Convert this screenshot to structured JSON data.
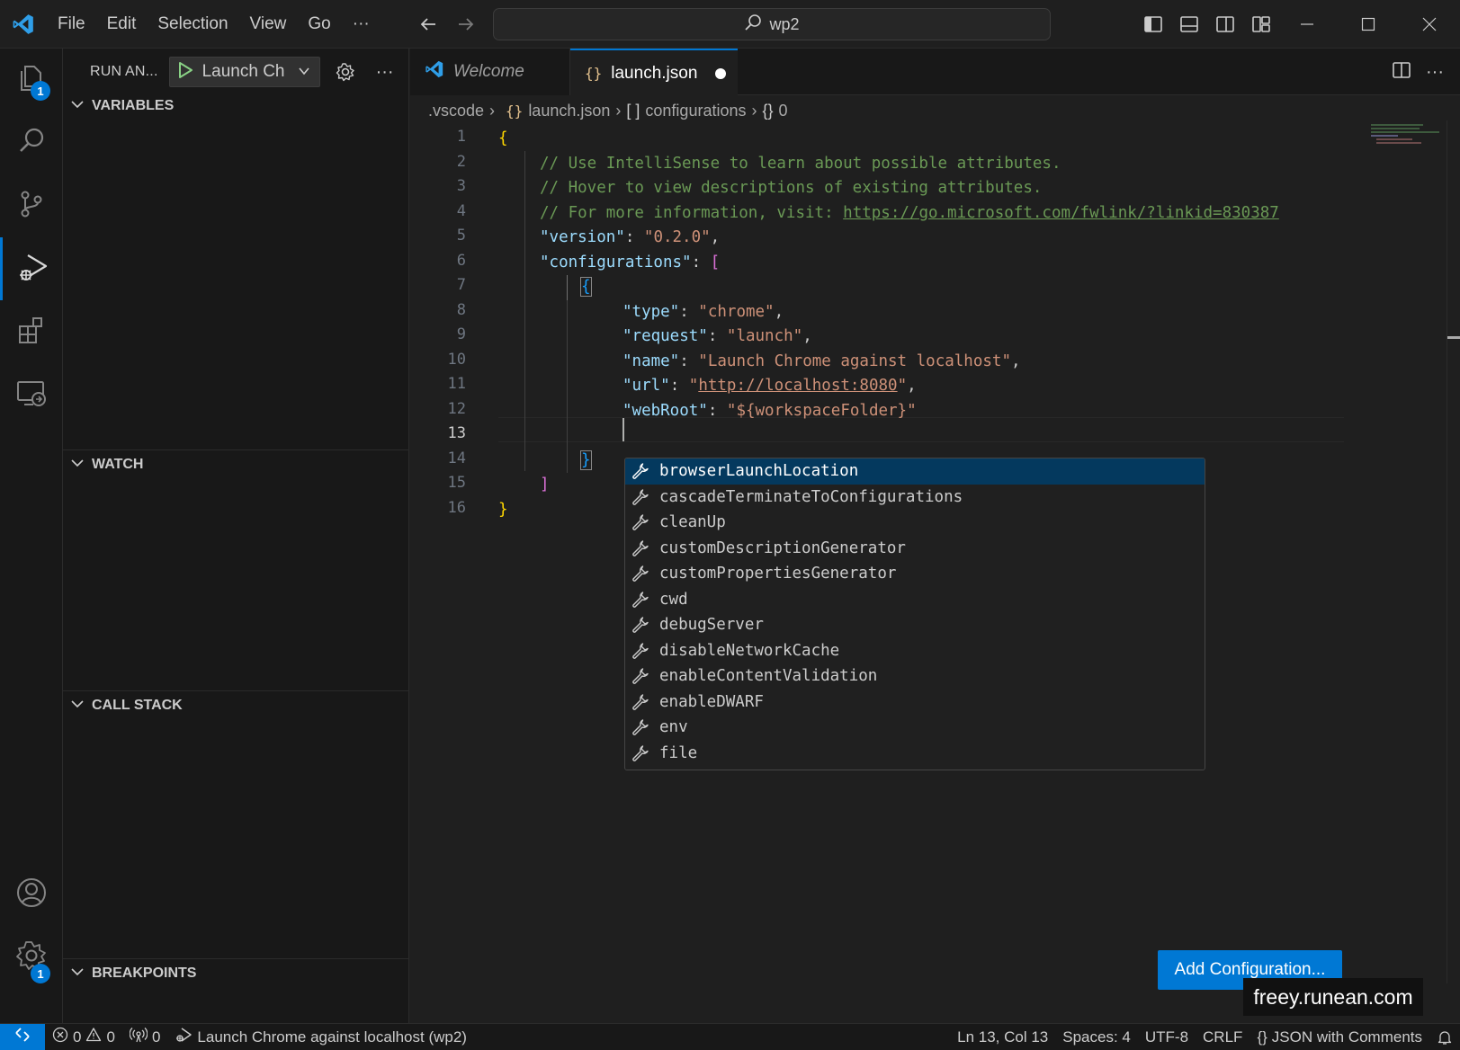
{
  "titlebar": {
    "menu": [
      "File",
      "Edit",
      "Selection",
      "View",
      "Go",
      "···"
    ],
    "search_text": "wp2",
    "icons": [
      "vscode-logo-icon",
      "back-arrow-icon",
      "forward-arrow-icon",
      "search-icon",
      "toggle-primary-sidebar-icon",
      "toggle-panel-icon",
      "toggle-secondary-sidebar-icon",
      "customize-layout-icon",
      "minimize-icon",
      "maximize-icon",
      "close-icon"
    ]
  },
  "activitybar": {
    "items": [
      "explorer",
      "search",
      "source-control",
      "run-and-debug",
      "extensions",
      "remote-explorer"
    ],
    "explorer_badge": "1",
    "manage_badge": "1",
    "active_color": "#0078d4"
  },
  "sidebar": {
    "title": "RUN AN...",
    "launch_config": "Launch Ch",
    "sections": {
      "variables": "VARIABLES",
      "watch": "WATCH",
      "call_stack": "CALL STACK",
      "breakpoints": "BREAKPOINTS"
    }
  },
  "tabs": {
    "welcome": "Welcome",
    "launch": "launch.json",
    "launch_icon": "{}"
  },
  "breadcrumb": {
    "folder": ".vscode",
    "file": "launch.json",
    "array": "configurations",
    "array_icon": "[ ]",
    "object": "0",
    "object_icon": "{}"
  },
  "editor": {
    "line_numbers": [
      "1",
      "2",
      "3",
      "4",
      "5",
      "6",
      "7",
      "8",
      "9",
      "10",
      "11",
      "12",
      "13",
      "14",
      "15",
      "16"
    ],
    "current_line": 13,
    "lines": {
      "l1": "{",
      "l2": "// Use IntelliSense to learn about possible attributes.",
      "l3": "// Hover to view descriptions of existing attributes.",
      "l4_pre": "// For more information, visit: ",
      "l4_link": "https://go.microsoft.com/fwlink/?linkid=830387",
      "l5_key": "\"version\"",
      "l5_val": "\"0.2.0\"",
      "l6_key": "\"configurations\"",
      "l6_br": "[",
      "l7": "{",
      "l8_key": "\"type\"",
      "l8_val": "\"chrome\"",
      "l9_key": "\"request\"",
      "l9_val": "\"launch\"",
      "l10_key": "\"name\"",
      "l10_val": "\"Launch Chrome against localhost\"",
      "l11_key": "\"url\"",
      "l11_val_q1": "\"",
      "l11_val_link": "http://localhost:8080",
      "l11_val_q2": "\"",
      "l12_key": "\"webRoot\"",
      "l12_val": "\"${workspaceFolder}\"",
      "l14": "}",
      "l15": "]",
      "l16": "}"
    }
  },
  "suggest": {
    "items": [
      "browserLaunchLocation",
      "cascadeTerminateToConfigurations",
      "cleanUp",
      "customDescriptionGenerator",
      "customPropertiesGenerator",
      "cwd",
      "debugServer",
      "disableNetworkCache",
      "enableContentValidation",
      "enableDWARF",
      "env",
      "file"
    ],
    "selected_index": 0
  },
  "add_configuration_label": "Add Configuration...",
  "watermark": "freey.runean.com",
  "statusbar": {
    "errors": "0",
    "warnings": "0",
    "ports": "0",
    "debug_target": "Launch Chrome against localhost (wp2)",
    "position": "Ln 13, Col 13",
    "spaces": "Spaces: 4",
    "encoding": "UTF-8",
    "eol": "CRLF",
    "language": "JSON with Comments",
    "language_icon": "{}"
  }
}
